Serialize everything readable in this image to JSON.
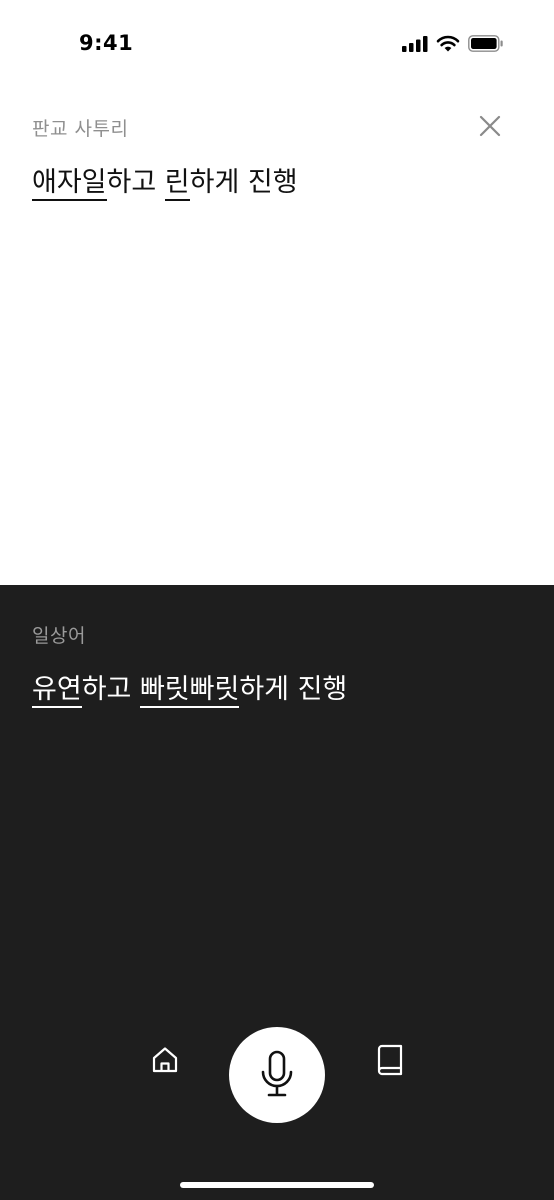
{
  "status_bar": {
    "time": "9:41"
  },
  "source": {
    "label": "판교 사투리",
    "sentence": [
      {
        "text": "애자일",
        "term": true
      },
      {
        "text": "하고 ",
        "term": false
      },
      {
        "text": "린",
        "term": true
      },
      {
        "text": "하게 진행",
        "term": false
      }
    ]
  },
  "target": {
    "label": "일상어",
    "sentence": [
      {
        "text": "유연",
        "term": true
      },
      {
        "text": "하고 ",
        "term": false
      },
      {
        "text": "빠릿빠릿",
        "term": true
      },
      {
        "text": "하게 진행",
        "term": false
      }
    ]
  },
  "icons": {
    "close": "close-icon",
    "home": "home-icon",
    "mic": "microphone-icon",
    "book": "book-icon"
  },
  "colors": {
    "bottom_panel": "#1e1e1e",
    "source_label": "#8f8f8f",
    "target_label": "#9a9a9a"
  }
}
